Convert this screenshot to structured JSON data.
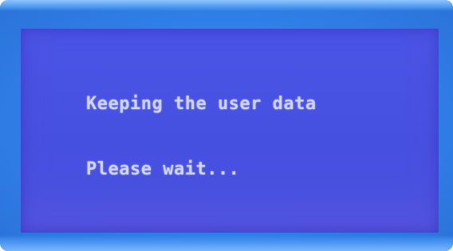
{
  "display": {
    "lines": [
      "Keeping the user data",
      "Please wait..."
    ],
    "colors": {
      "bezel": "#2f7fe8",
      "screen_background": "#4650e0",
      "text": "#cfd3f4"
    }
  }
}
